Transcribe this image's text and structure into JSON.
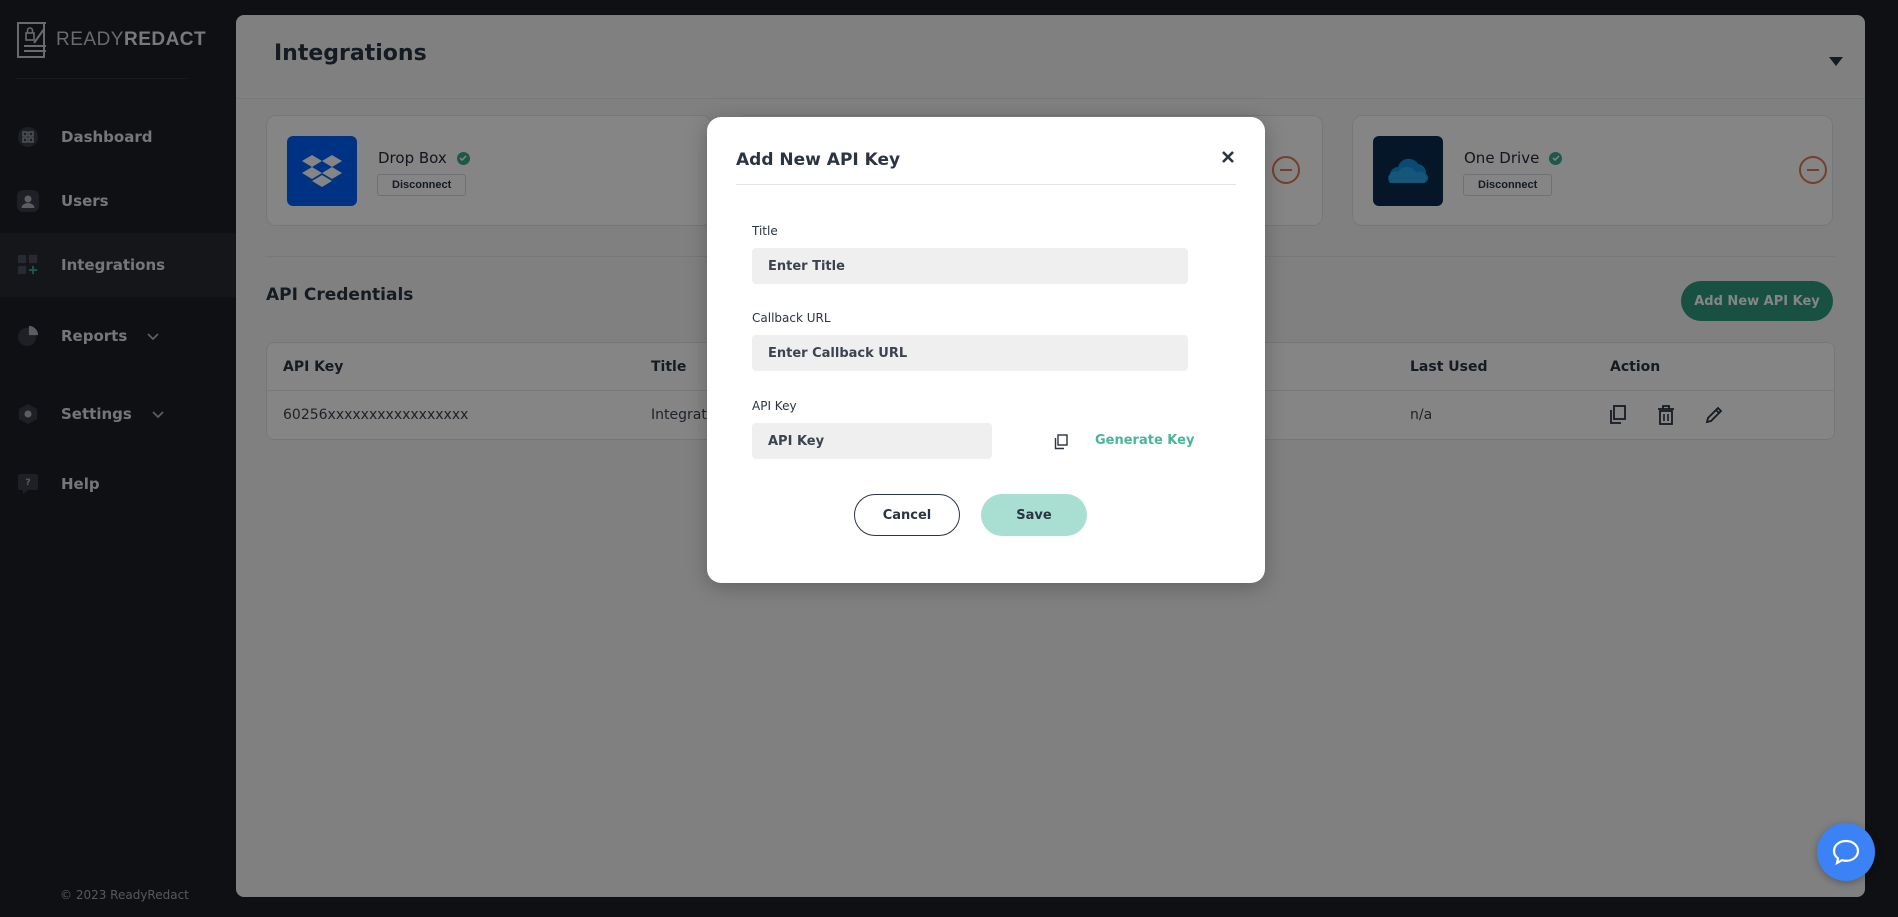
{
  "brand": {
    "name_light": "READY",
    "name_bold": "REDACT",
    "logo_icon": "document-lock-icon"
  },
  "sidebar": {
    "items": [
      {
        "label": "Dashboard",
        "icon": "dashboard-icon"
      },
      {
        "label": "Users",
        "icon": "user-icon"
      },
      {
        "label": "Integrations",
        "icon": "integrations-icon",
        "active": true
      },
      {
        "label": "Reports",
        "icon": "pie-chart-icon",
        "has_caret": true
      },
      {
        "label": "Settings",
        "icon": "settings-icon",
        "has_caret": true
      },
      {
        "label": "Help",
        "icon": "help-icon"
      }
    ],
    "copyright": "© 2023 ReadyRedact"
  },
  "header": {
    "title": "Integrations"
  },
  "integrations": [
    {
      "name": "Drop Box",
      "action": "Disconnect",
      "connected": true,
      "logo_color": "#0061fe"
    },
    {
      "name": "One Drive",
      "action": "Disconnect",
      "connected": true,
      "logo_color": "#0c2b4f"
    }
  ],
  "credentials": {
    "title": "API Credentials",
    "add_button": "Add New API Key",
    "columns": [
      "API Key",
      "Title",
      "Last Used",
      "Action"
    ],
    "rows": [
      {
        "api_key": "60256xxxxxxxxxxxxxxxxx",
        "title": "Integratio",
        "last_used": "n/a"
      }
    ]
  },
  "modal": {
    "title": "Add New API Key",
    "title_label": "Title",
    "title_placeholder": "Enter Title",
    "callback_label": "Callback URL",
    "callback_placeholder": "Enter Callback URL",
    "apikey_label": "API Key",
    "apikey_placeholder": "API Key",
    "generate_label": "Generate Key",
    "cancel_label": "Cancel",
    "save_label": "Save"
  },
  "colors": {
    "accent": "#2e9b7e",
    "link": "#49b59a",
    "warning": "#e0794f",
    "chat": "#3b82f6"
  }
}
